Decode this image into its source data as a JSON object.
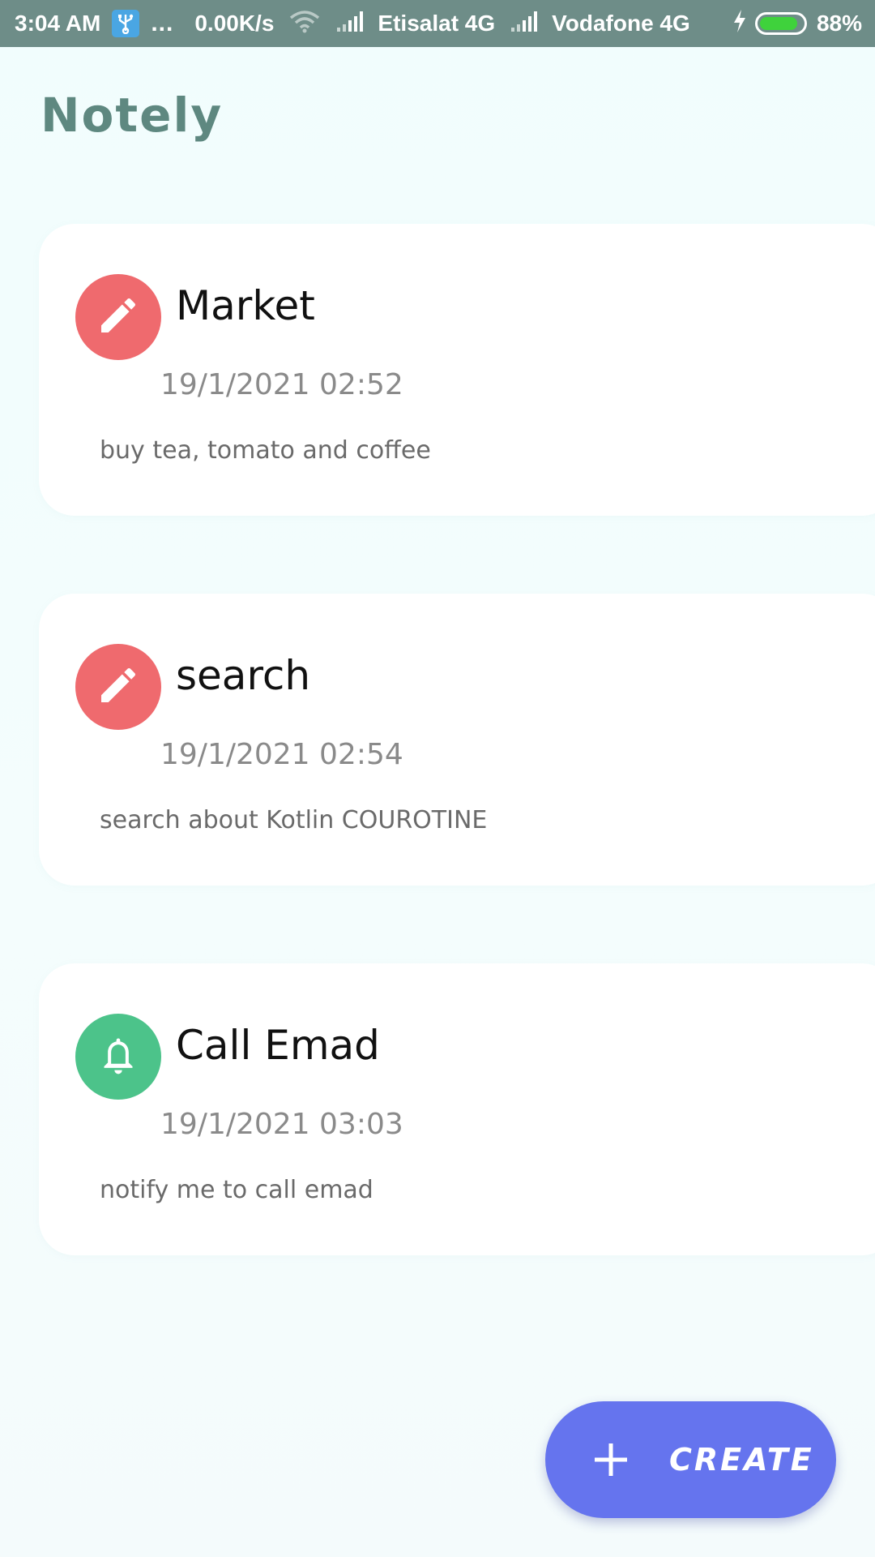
{
  "status_bar": {
    "time": "3:04 AM",
    "dots": "...",
    "net_speed": "0.00K/s",
    "carrier1": "Etisalat 4G",
    "carrier2": "Vodafone 4G",
    "battery_percent": "88%",
    "battery_level": 0.88,
    "battery_color": "#3fd23c"
  },
  "app": {
    "title": "Notely"
  },
  "notes": [
    {
      "title": "Market",
      "date": "19/1/2021 02:52",
      "body": "buy tea, tomato and coffee",
      "icon": "pencil-icon",
      "icon_color": "#ef6a6e"
    },
    {
      "title": "search",
      "date": "19/1/2021 02:54",
      "body": "search about Kotlin COUROTINE",
      "icon": "pencil-icon",
      "icon_color": "#ef6a6e"
    },
    {
      "title": "Call Emad",
      "date": "19/1/2021 03:03",
      "body": "notify me to call emad",
      "icon": "bell-icon",
      "icon_color": "#4cc38a"
    }
  ],
  "fab": {
    "label": "CREATE",
    "icon": "plus-icon",
    "color": "#6574ee"
  }
}
